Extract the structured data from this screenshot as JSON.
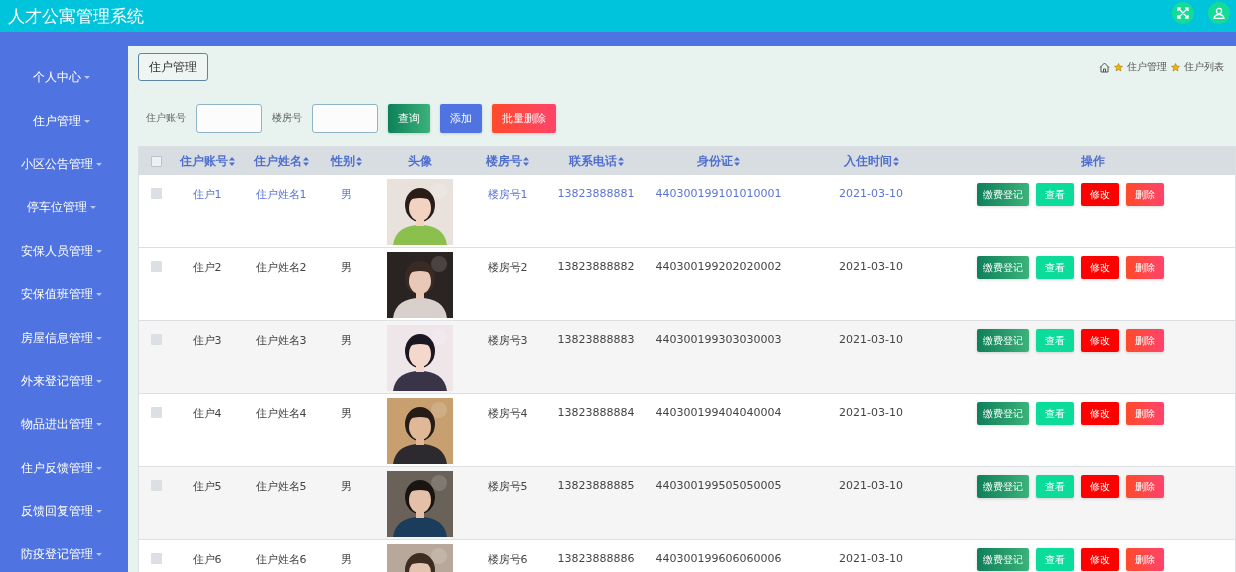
{
  "app": {
    "title": "人才公寓管理系统"
  },
  "sidebar": {
    "items": [
      {
        "label": "个人中心"
      },
      {
        "label": "住户管理"
      },
      {
        "label": "小区公告管理"
      },
      {
        "label": "停车位管理"
      },
      {
        "label": "安保人员管理"
      },
      {
        "label": "安保值班管理"
      },
      {
        "label": "房屋信息管理"
      },
      {
        "label": "外来登记管理"
      },
      {
        "label": "物品进出管理"
      },
      {
        "label": "住户反馈管理"
      },
      {
        "label": "反馈回复管理"
      },
      {
        "label": "防疫登记管理"
      }
    ]
  },
  "page": {
    "tab": "住户管理",
    "breadcrumb": [
      "住户管理",
      "住户列表"
    ]
  },
  "search": {
    "fields": [
      {
        "label": "住户账号"
      },
      {
        "label": "楼房号"
      }
    ],
    "buttons": [
      {
        "label": "查询",
        "kind": "query"
      },
      {
        "label": "添加",
        "kind": "add"
      },
      {
        "label": "批量删除",
        "kind": "remove"
      }
    ]
  },
  "table": {
    "all_checked": false,
    "columns": [
      {
        "label": "住户账号",
        "sortable": true
      },
      {
        "label": "住户姓名",
        "sortable": true
      },
      {
        "label": "性别",
        "sortable": true
      },
      {
        "label": "头像",
        "sortable": false
      },
      {
        "label": "楼房号",
        "sortable": true
      },
      {
        "label": "联系电话",
        "sortable": true
      },
      {
        "label": "身份证",
        "sortable": true
      },
      {
        "label": "入住时间",
        "sortable": true
      },
      {
        "label": "操作",
        "sortable": false
      }
    ],
    "rows": [
      {
        "checked": false,
        "highlighted": true,
        "account": "住户1",
        "name": "住户姓名1",
        "sex": "男",
        "building": "楼房号1",
        "phone": "13823888881",
        "id_card": "440300199101010001",
        "date": "2021-03-10",
        "actions": [
          {
            "label": "缴费登记",
            "kind": "pay"
          },
          {
            "label": "查看",
            "kind": "view"
          },
          {
            "label": "修改",
            "kind": "edit"
          },
          {
            "label": "删除",
            "kind": "remove"
          }
        ]
      },
      {
        "checked": false,
        "highlighted": false,
        "account": "住户2",
        "name": "住户姓名2",
        "sex": "男",
        "building": "楼房号2",
        "phone": "13823888882",
        "id_card": "440300199202020002",
        "date": "2021-03-10",
        "actions": [
          {
            "label": "缴费登记",
            "kind": "pay"
          },
          {
            "label": "查看",
            "kind": "view"
          },
          {
            "label": "修改",
            "kind": "edit"
          },
          {
            "label": "删除",
            "kind": "remove"
          }
        ]
      },
      {
        "checked": false,
        "highlighted": false,
        "account": "住户3",
        "name": "住户姓名3",
        "sex": "男",
        "building": "楼房号3",
        "phone": "13823888883",
        "id_card": "440300199303030003",
        "date": "2021-03-10",
        "actions": [
          {
            "label": "缴费登记",
            "kind": "pay"
          },
          {
            "label": "查看",
            "kind": "view"
          },
          {
            "label": "修改",
            "kind": "edit"
          },
          {
            "label": "删除",
            "kind": "remove"
          }
        ]
      },
      {
        "checked": false,
        "highlighted": false,
        "account": "住户4",
        "name": "住户姓名4",
        "sex": "男",
        "building": "楼房号4",
        "phone": "13823888884",
        "id_card": "440300199404040004",
        "date": "2021-03-10",
        "actions": [
          {
            "label": "缴费登记",
            "kind": "pay"
          },
          {
            "label": "查看",
            "kind": "view"
          },
          {
            "label": "修改",
            "kind": "edit"
          },
          {
            "label": "删除",
            "kind": "remove"
          }
        ]
      },
      {
        "checked": false,
        "highlighted": false,
        "account": "住户5",
        "name": "住户姓名5",
        "sex": "男",
        "building": "楼房号5",
        "phone": "13823888885",
        "id_card": "440300199505050005",
        "date": "2021-03-10",
        "actions": [
          {
            "label": "缴费登记",
            "kind": "pay"
          },
          {
            "label": "查看",
            "kind": "view"
          },
          {
            "label": "修改",
            "kind": "edit"
          },
          {
            "label": "删除",
            "kind": "remove"
          }
        ]
      },
      {
        "checked": false,
        "highlighted": false,
        "account": "住户6",
        "name": "住户姓名6",
        "sex": "男",
        "building": "楼房号6",
        "phone": "13823888886",
        "id_card": "440300199606060006",
        "date": "2021-03-10",
        "actions": [
          {
            "label": "缴费登记",
            "kind": "pay"
          },
          {
            "label": "查看",
            "kind": "view"
          },
          {
            "label": "修改",
            "kind": "edit"
          },
          {
            "label": "删除",
            "kind": "remove"
          }
        ]
      }
    ]
  }
}
